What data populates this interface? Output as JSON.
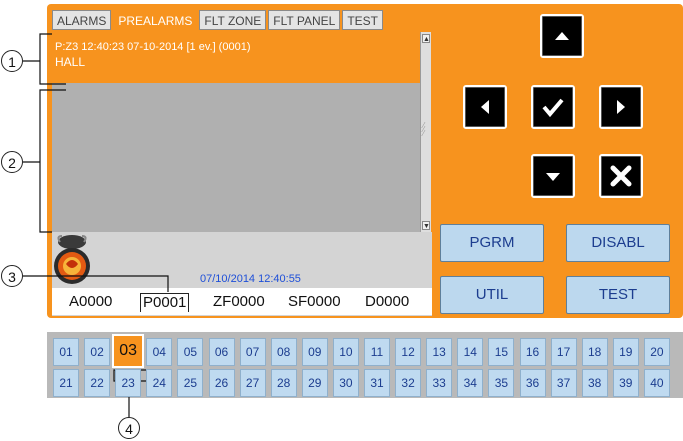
{
  "tabs": [
    {
      "label": "ALARMS"
    },
    {
      "label": "PREALARMS"
    },
    {
      "label": "FLT ZONE"
    },
    {
      "label": "FLT PANEL"
    },
    {
      "label": "TEST"
    }
  ],
  "active_tab": "PREALARMS",
  "event": {
    "line1": "P:Z3 12:40:23 07-10-2014 [1 ev.] (0001)",
    "line2": "HALL"
  },
  "status": {
    "datetime": "07/10/2014 12:40:55"
  },
  "counters": [
    {
      "label": "A0000"
    },
    {
      "label": "P0001"
    },
    {
      "label": "ZF0000"
    },
    {
      "label": "SF0000"
    },
    {
      "label": "D0000"
    }
  ],
  "nav_buttons": {
    "up_icon": "arrow-up-icon",
    "left_icon": "arrow-left-icon",
    "ok_icon": "checkmark-icon",
    "right_icon": "arrow-right-icon",
    "down_icon": "arrow-down-icon",
    "cancel_icon": "cancel-x-icon"
  },
  "function_buttons": {
    "pgrm": "PGRM",
    "disabl": "DISABL",
    "util": "UTIL",
    "test": "TEST"
  },
  "zones": {
    "row1": [
      "01",
      "02",
      "03",
      "04",
      "05",
      "06",
      "07",
      "08",
      "09",
      "10",
      "11",
      "12",
      "13",
      "14",
      "15",
      "16",
      "17",
      "18",
      "19",
      "20"
    ],
    "row2": [
      "21",
      "22",
      "23",
      "24",
      "25",
      "26",
      "27",
      "28",
      "29",
      "30",
      "31",
      "32",
      "33",
      "34",
      "35",
      "36",
      "37",
      "38",
      "39",
      "40"
    ],
    "selected": "03"
  },
  "callouts": [
    "1",
    "2",
    "3",
    "4"
  ],
  "colors": {
    "accent": "#f7931e",
    "button": "#bcd8ee",
    "datetime": "#1e4fd8"
  }
}
